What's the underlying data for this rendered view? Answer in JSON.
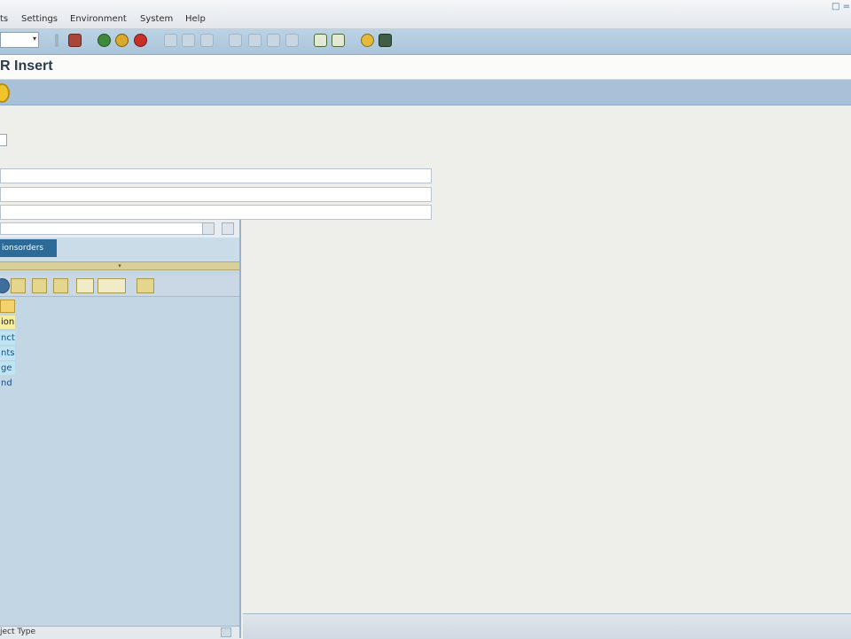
{
  "menubar": {
    "items": [
      "ts",
      "Settings",
      "Environment",
      "System",
      "Help"
    ],
    "system_icons": "□ ="
  },
  "toolbar": {
    "command_value": "",
    "dropdown_glyph": "▾"
  },
  "screen": {
    "title": "R Insert"
  },
  "form": {
    "field1_value": "",
    "field2_value": "",
    "field3_value": ""
  },
  "left_panel": {
    "dropdown_value": "",
    "tab_label": "ionsorders",
    "splitter_glyph": "▾",
    "tree_items": [
      "",
      "ion",
      "nct",
      "nts",
      "ge",
      "nd"
    ],
    "footer_text": "ject Type"
  }
}
